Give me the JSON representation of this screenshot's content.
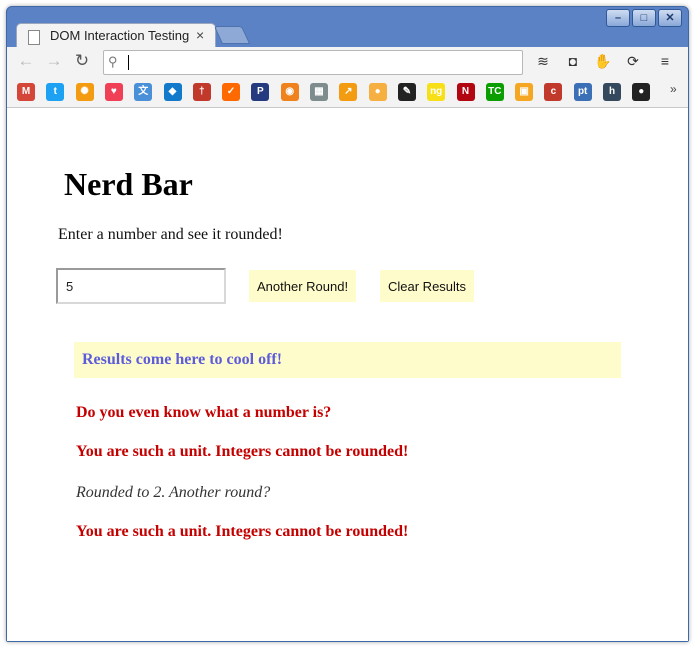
{
  "browser": {
    "tab_title": "DOM Interaction Testing",
    "tab_close": "×",
    "url": "",
    "bookmarks_overflow": "»",
    "window_buttons": [
      "–",
      "□",
      "✕"
    ],
    "bookmark_icons": [
      {
        "name": "gmail",
        "color": "#d44638",
        "glyph": "M"
      },
      {
        "name": "twitter",
        "color": "#1da1f2",
        "glyph": "t"
      },
      {
        "name": "orange-badge",
        "color": "#f39c12",
        "glyph": "✺"
      },
      {
        "name": "pocket",
        "color": "#ef4056",
        "glyph": "♥"
      },
      {
        "name": "translate",
        "color": "#4a90d9",
        "glyph": "文"
      },
      {
        "name": "chase",
        "color": "#117aca",
        "glyph": "◆"
      },
      {
        "name": "red-circle",
        "color": "#c0392b",
        "glyph": "†"
      },
      {
        "name": "checkmark",
        "color": "#ff6a00",
        "glyph": "✓"
      },
      {
        "name": "paypal",
        "color": "#253b80",
        "glyph": "P"
      },
      {
        "name": "orange-square",
        "color": "#f0821e",
        "glyph": "◉"
      },
      {
        "name": "calendar",
        "color": "#7f8c8d",
        "glyph": "▦"
      },
      {
        "name": "chart",
        "color": "#f39c12",
        "glyph": "↗"
      },
      {
        "name": "coin",
        "color": "#f5b041",
        "glyph": "●"
      },
      {
        "name": "squirrel",
        "color": "#222222",
        "glyph": "✎"
      },
      {
        "name": "ng",
        "color": "#f7e017",
        "glyph": "ng"
      },
      {
        "name": "netflix",
        "color": "#b20710",
        "glyph": "N"
      },
      {
        "name": "techcrunch",
        "color": "#0a9e01",
        "glyph": "TC"
      },
      {
        "name": "box",
        "color": "#f5a623",
        "glyph": "▣"
      },
      {
        "name": "red-c",
        "color": "#c0392b",
        "glyph": "c"
      },
      {
        "name": "pivotal",
        "color": "#3b6fb6",
        "glyph": "pt"
      },
      {
        "name": "hacker",
        "color": "#34495e",
        "glyph": "h"
      },
      {
        "name": "github",
        "color": "#222222",
        "glyph": "●"
      }
    ]
  },
  "page": {
    "title": "Nerd Bar",
    "instructions": "Enter a number and see it rounded!",
    "input_value": "5",
    "round_button": "Another Round!",
    "clear_button": "Clear Results",
    "results_header": "Results come here to cool off!",
    "results": [
      {
        "text": "Do you even know what a number is?",
        "type": "error"
      },
      {
        "text": "You are such a unit. Integers cannot be rounded!",
        "type": "error"
      },
      {
        "text": "Rounded to 2. Another round?",
        "type": "ok"
      },
      {
        "text": "You are such a unit. Integers cannot be rounded!",
        "type": "error"
      }
    ]
  },
  "colors": {
    "button_bg": "#fffccc",
    "results_header_text": "#5c5cdb",
    "error_text": "#c40000",
    "frame_blue": "#5a82c4"
  }
}
